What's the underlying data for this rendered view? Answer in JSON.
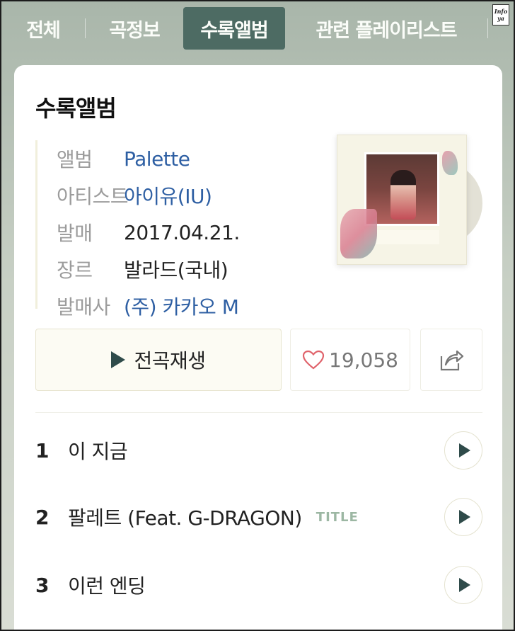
{
  "tabs": [
    {
      "label": "전체"
    },
    {
      "label": "곡정보"
    },
    {
      "label": "수록앨범",
      "active": true
    },
    {
      "label": "관련 플레이리스트"
    }
  ],
  "watermark": "Infoya",
  "section_title": "수록앨범",
  "album_info": [
    {
      "key": "앨범",
      "value": "Palette"
    },
    {
      "key": "아티스트",
      "value": "아이유(IU)"
    },
    {
      "key": "발매",
      "value": "2017.04.21."
    },
    {
      "key": "장르",
      "value": "발라드(국내)"
    },
    {
      "key": "발매사",
      "value": "(주) 카카오 M"
    }
  ],
  "buttons": {
    "play_all": "전곡재생",
    "like_count": "19,058"
  },
  "tracks": [
    {
      "no": "1",
      "title": "이 지금",
      "badge": ""
    },
    {
      "no": "2",
      "title": "팔레트 (Feat. G-DRAGON)",
      "badge": "TITLE"
    },
    {
      "no": "3",
      "title": "이런 엔딩",
      "badge": ""
    }
  ],
  "colors": {
    "accent": "#4d6b63",
    "link": "#2e5fa3",
    "heart": "#e0636b",
    "title_badge": "#9cb7a3"
  },
  "icons": [
    "play-icon",
    "heart-icon",
    "share-icon"
  ]
}
